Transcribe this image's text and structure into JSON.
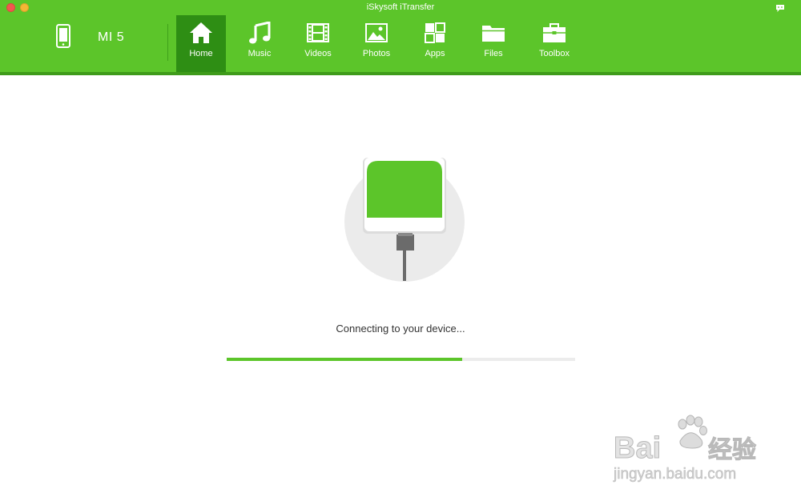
{
  "window": {
    "title": "iSkysoft iTransfer"
  },
  "device": {
    "name": "MI 5"
  },
  "tabs": [
    {
      "label": "Home",
      "icon": "home-icon",
      "active": true
    },
    {
      "label": "Music",
      "icon": "music-icon",
      "active": false
    },
    {
      "label": "Videos",
      "icon": "film-icon",
      "active": false
    },
    {
      "label": "Photos",
      "icon": "photo-icon",
      "active": false
    },
    {
      "label": "Apps",
      "icon": "apps-icon",
      "active": false
    },
    {
      "label": "Files",
      "icon": "folder-icon",
      "active": false
    },
    {
      "label": "Toolbox",
      "icon": "toolbox-icon",
      "active": false
    }
  ],
  "status": {
    "message": "Connecting to your device...",
    "progress_percent": 67.5
  },
  "watermark": {
    "brand": "Baidu",
    "brand_cn": "经验",
    "url": "jingyan.baidu.com"
  },
  "colors": {
    "accent": "#5cc52a",
    "active_tab": "#2e8e14",
    "progress_track": "#ececec"
  }
}
